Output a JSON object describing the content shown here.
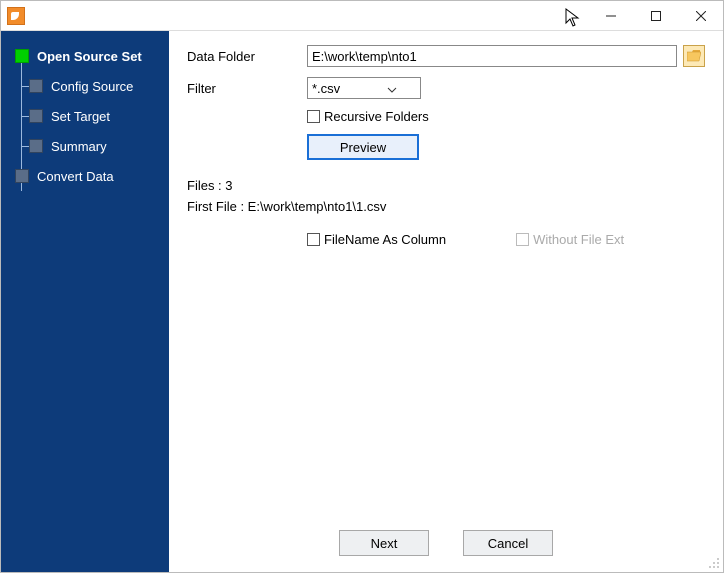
{
  "sidebar": {
    "items": [
      {
        "label": "Open Source Set"
      },
      {
        "label": "Config Source"
      },
      {
        "label": "Set Target"
      },
      {
        "label": "Summary"
      },
      {
        "label": "Convert Data"
      }
    ]
  },
  "form": {
    "data_folder_label": "Data Folder",
    "data_folder_value": "E:\\work\\temp\\nto1",
    "filter_label": "Filter",
    "filter_value": "*.csv",
    "recursive_label": "Recursive Folders",
    "preview_label": "Preview",
    "files_count_label": "Files : 3",
    "first_file_label": "First File : E:\\work\\temp\\nto1\\1.csv",
    "filename_col_label": "FileName As Column",
    "without_ext_label": "Without File Ext"
  },
  "footer": {
    "next_label": "Next",
    "cancel_label": "Cancel"
  }
}
